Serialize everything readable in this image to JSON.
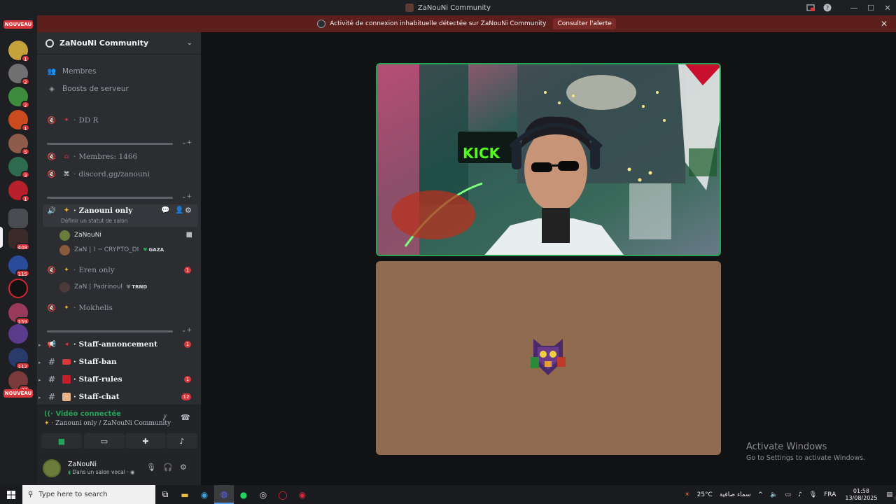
{
  "window": {
    "title": "ZaNouNi Community"
  },
  "alert": {
    "text": "Activité de connexion inhabituelle détectée sur ZaNouNi Community",
    "button": "Consulter l'alerte"
  },
  "rail": {
    "nouveau_top": "NOUVEAU",
    "nouveau_bottom": "NOUVEAU",
    "badges": [
      "1",
      "1",
      "2",
      "2",
      "1",
      "5",
      "3",
      "1",
      "408",
      "115",
      "159",
      "112",
      "37"
    ]
  },
  "sidebar": {
    "server_name": "ZaNouNi Community",
    "top_items": [
      "Membres",
      "Boosts de serveur"
    ],
    "channels": {
      "ddr": "DD R",
      "members": "Membres: 1466",
      "discord": "discord.gg/zanouni",
      "zanouni_only": "Zanouni only",
      "zanouni_status": "Définir un statut de salon",
      "eren_only": "Eren only",
      "mokhelis": "Mokhelis",
      "staff_annonce": "Staff-annoncement",
      "staff_ban": "Staff-ban",
      "staff_rules": "Staff-rules",
      "staff_chat": "Staff-chat"
    },
    "channel_badges": {
      "eren": "1",
      "staff_annonce": "1",
      "staff_rules": "1",
      "staff_chat": "12"
    },
    "voice_users": [
      {
        "name": "ZaNouNi",
        "tag": ""
      },
      {
        "name": "ZaN | ⌇ ─ CRYPTO_DI",
        "tag": "GAZA"
      },
      {
        "name": "ZaN | Padrinoul",
        "tag": "TRND"
      }
    ]
  },
  "voice_panel": {
    "status": "Vidéo connectée",
    "channel": "Zanouni only / ZaNouNi Community"
  },
  "user_panel": {
    "name": "ZaNouNi",
    "status": "Dans un salon vocal"
  },
  "watermark": {
    "line1": "Activate Windows",
    "line2": "Go to Settings to activate Windows."
  },
  "taskbar": {
    "search_placeholder": "Type here to search",
    "weather_temp": "25°C",
    "weather_text": "سماء صافية",
    "lang": "FRA",
    "time": "01:58",
    "date": "13/08/2025",
    "notifications": "23"
  },
  "colors": {
    "accent_green": "#23a55a",
    "badge_red": "#da373c",
    "alert_bg": "#5c1f1c",
    "avatar_tile": "#916b4f"
  }
}
